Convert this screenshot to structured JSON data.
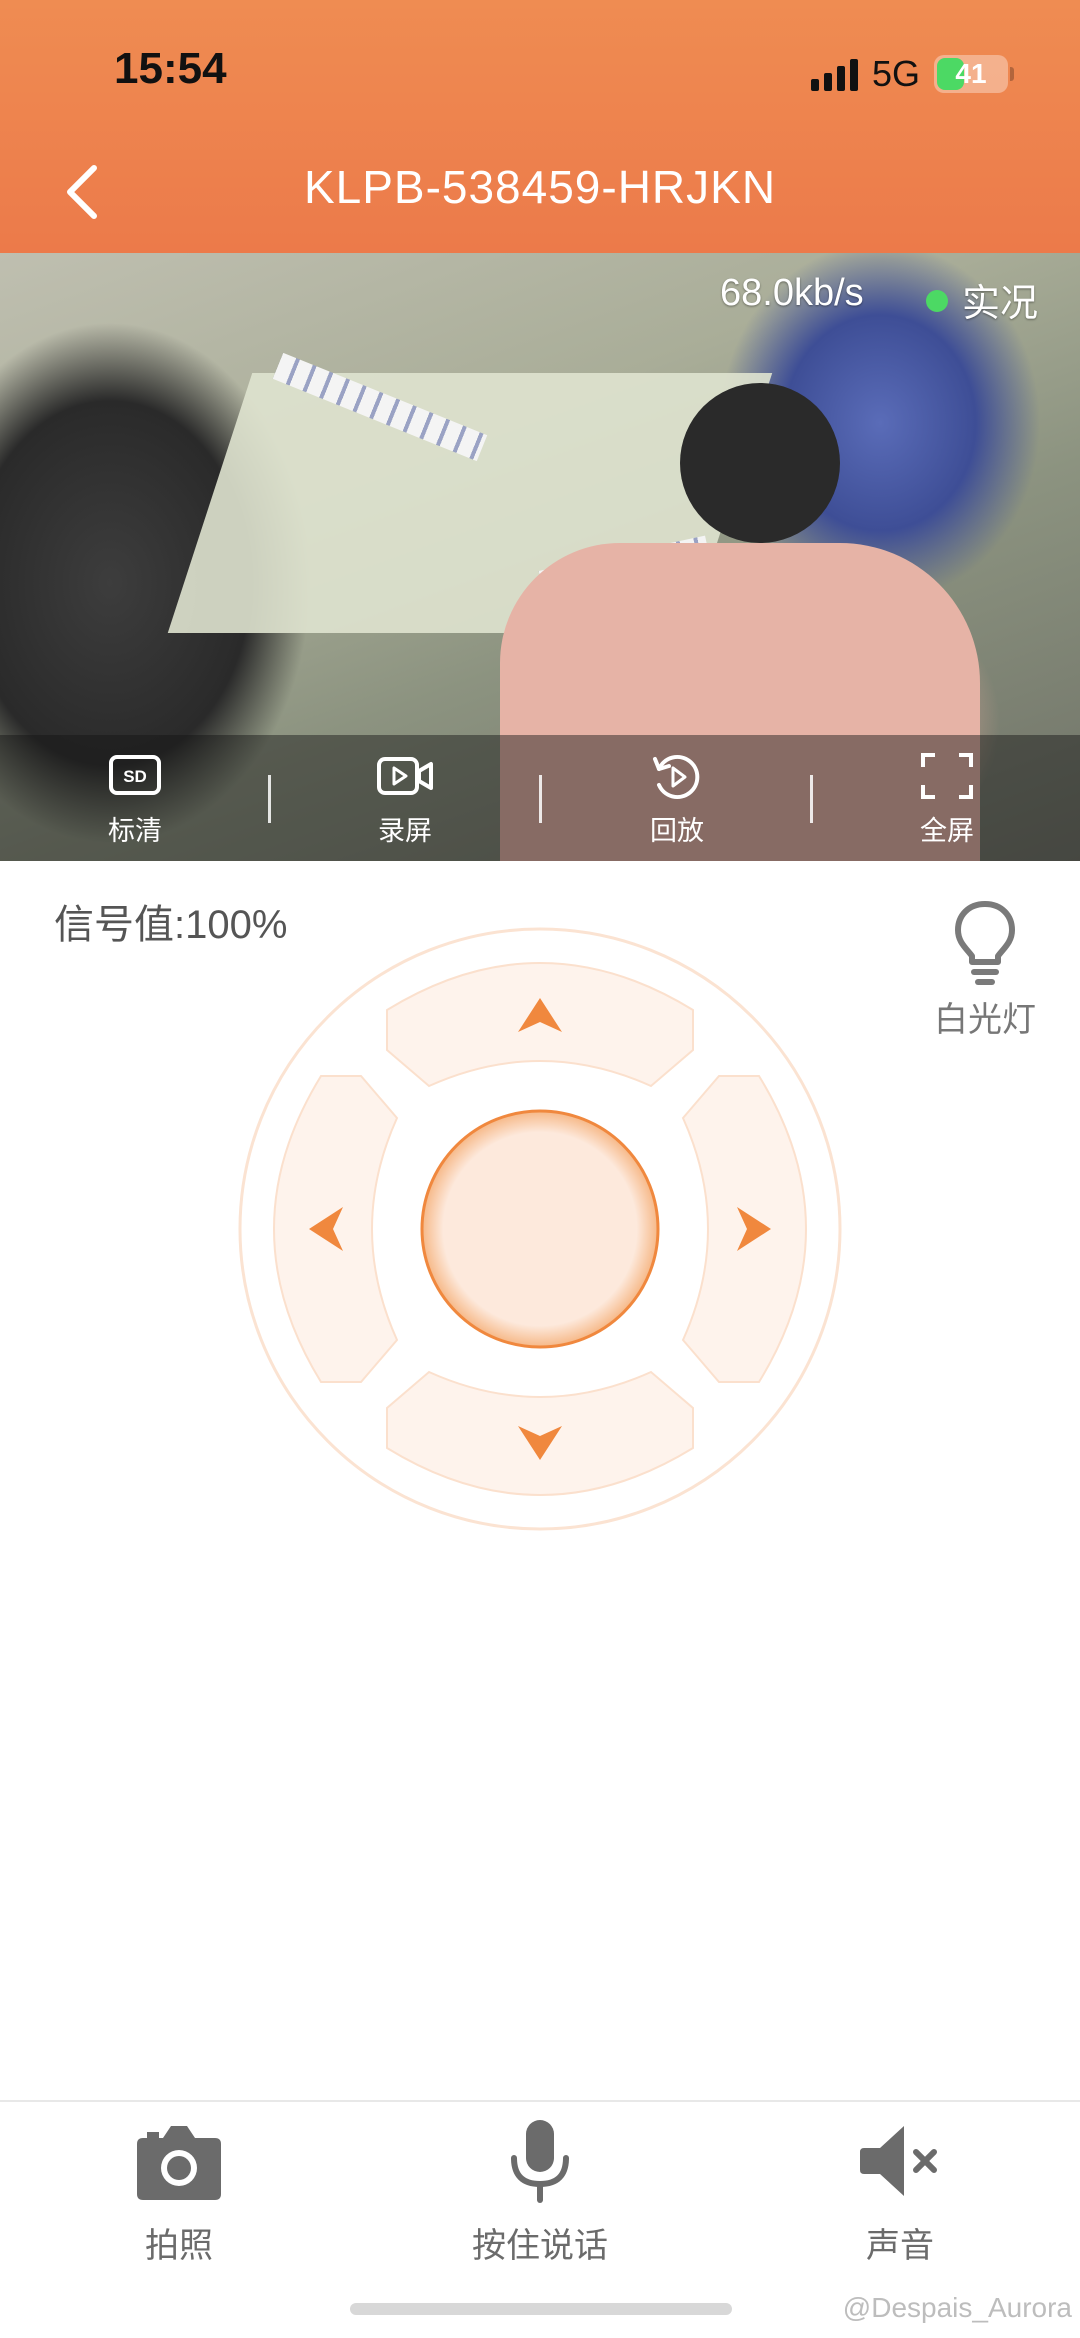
{
  "status_bar": {
    "time": "15:54",
    "network": "5G",
    "battery": "41",
    "battery_level_percent": 41
  },
  "header": {
    "title": "KLPB-538459-HRJKN",
    "back_icon": "chevron-left-icon"
  },
  "video": {
    "bitrate": "68.0kb/s",
    "live_label": "实况",
    "live_dot_color": "#4cd964",
    "controls": [
      {
        "label": "标清",
        "icon": "sd-quality-icon"
      },
      {
        "label": "录屏",
        "icon": "record-video-icon"
      },
      {
        "label": "回放",
        "icon": "playback-icon"
      },
      {
        "label": "全屏",
        "icon": "fullscreen-icon"
      }
    ]
  },
  "panel": {
    "signal_text": "信号值:100%",
    "white_light_label": "白光灯",
    "ptz_accent_color": "#f0883e"
  },
  "bottom_bar": {
    "items": [
      {
        "label": "拍照",
        "icon": "camera-icon"
      },
      {
        "label": "按住说话",
        "icon": "microphone-icon"
      },
      {
        "label": "声音",
        "icon": "speaker-muted-icon"
      }
    ]
  },
  "watermark": "@Despais_Aurora",
  "theme": {
    "header_color": "#ec7a4a",
    "accent": "#f0883e"
  }
}
